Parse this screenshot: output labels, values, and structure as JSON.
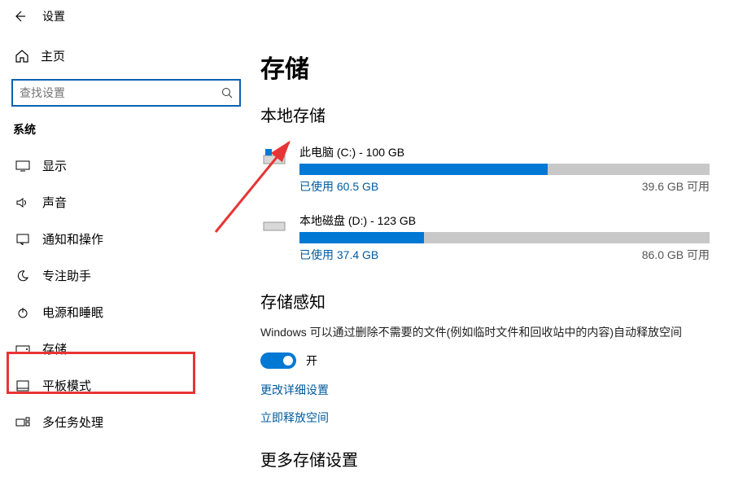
{
  "header": {
    "title": "设置"
  },
  "sidebar": {
    "home": "主页",
    "search_placeholder": "查找设置",
    "section": "系统",
    "items": [
      {
        "label": "显示"
      },
      {
        "label": "声音"
      },
      {
        "label": "通知和操作"
      },
      {
        "label": "专注助手"
      },
      {
        "label": "电源和睡眠"
      },
      {
        "label": "存储"
      },
      {
        "label": "平板模式"
      },
      {
        "label": "多任务处理"
      }
    ]
  },
  "main": {
    "title": "存储",
    "local_storage": "本地存储",
    "drives": [
      {
        "name": "此电脑 (C:) - 100 GB",
        "used": "已使用 60.5 GB",
        "free": "39.6 GB 可用",
        "pct": 60.5
      },
      {
        "name": "本地磁盘 (D:) - 123 GB",
        "used": "已使用 37.4 GB",
        "free": "86.0 GB 可用",
        "pct": 30.4
      }
    ],
    "sense_title": "存储感知",
    "sense_desc": "Windows 可以通过删除不需要的文件(例如临时文件和回收站中的内容)自动释放空间",
    "toggle_label": "开",
    "link_detail": "更改详细设置",
    "link_free": "立即释放空间",
    "more_title": "更多存储设置"
  }
}
